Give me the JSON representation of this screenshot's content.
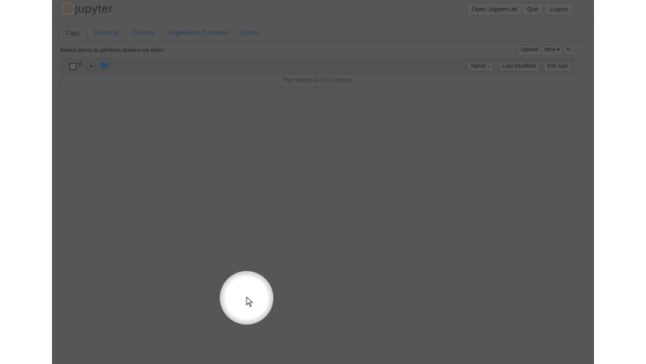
{
  "header": {
    "logo_text": "jupyter",
    "buttons": [
      "Open JupyterLab",
      "Quit",
      "Logout"
    ]
  },
  "tabs": [
    "Files",
    "Running",
    "Clusters",
    "SageMaker Examples",
    "Conda"
  ],
  "toolbar": {
    "hint": "Select items to perform actions on them.",
    "upload_label": "Upload",
    "new_label": "New ▾",
    "refresh_icon": "refresh-icon"
  },
  "file_list": {
    "selected_count": "0",
    "dropdown_glyph": "▾",
    "breadcrumb": "/",
    "columns": {
      "name": "Name ↓",
      "last_modified": "Last Modified",
      "file_size": "File size"
    },
    "empty_message": "The notebook list is empty."
  },
  "colors": {
    "dim_overlay": "#565656",
    "link": "#2a3f55",
    "logo_orange": "#7a5a3c"
  }
}
